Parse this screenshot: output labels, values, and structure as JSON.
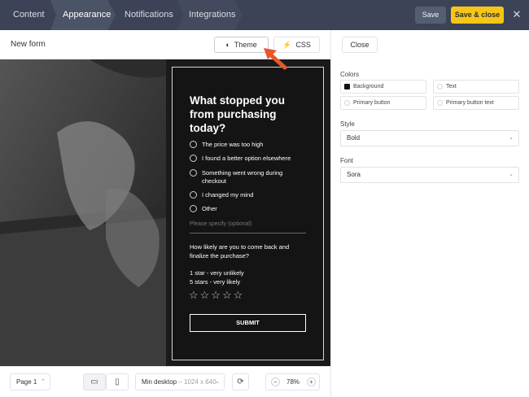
{
  "tabs": [
    {
      "label": "Content"
    },
    {
      "label": "Appearance"
    },
    {
      "label": "Notifications"
    },
    {
      "label": "Integrations"
    }
  ],
  "header": {
    "save_label": "Save",
    "save_close_label": "Save & close",
    "close_glyph": "✕"
  },
  "editor": {
    "form_name": "New form",
    "theme_label": "Theme",
    "css_label": "CSS",
    "close_label": "Close"
  },
  "panel": {
    "colors_heading": "Colors",
    "colors": [
      {
        "label": "Background",
        "value": "#111111"
      },
      {
        "label": "Text",
        "value": "#ffffff"
      },
      {
        "label": "Primary button",
        "value": "#ffffff"
      },
      {
        "label": "Primary button text",
        "value": "#ffffff"
      }
    ],
    "style_heading": "Style",
    "style_value": "Bold",
    "font_heading": "Font",
    "font_value": "Sora"
  },
  "survey": {
    "question": "What stopped you from purchasing today?",
    "options": [
      "The price was too high",
      "I found a better option elsewhere",
      "Something went wrong during checkout",
      "I changed my mind",
      "Other"
    ],
    "specify_placeholder": "Please specify (optional)",
    "question2": "How likely are you to come back and finalize the purchase?",
    "scale_low": "1 star - very unlikely",
    "scale_high": "5 stars - very likely",
    "stars": "☆☆☆☆☆",
    "submit_label": "SUBMIT"
  },
  "bottom": {
    "page_label": "Page 1",
    "device_label": "Min desktop",
    "device_size": "– 1024 x 640",
    "zoom_value": "78%"
  },
  "colors": {
    "topbar": "#3c4356",
    "accent": "#f5c518",
    "arrow": "#e8572a"
  }
}
